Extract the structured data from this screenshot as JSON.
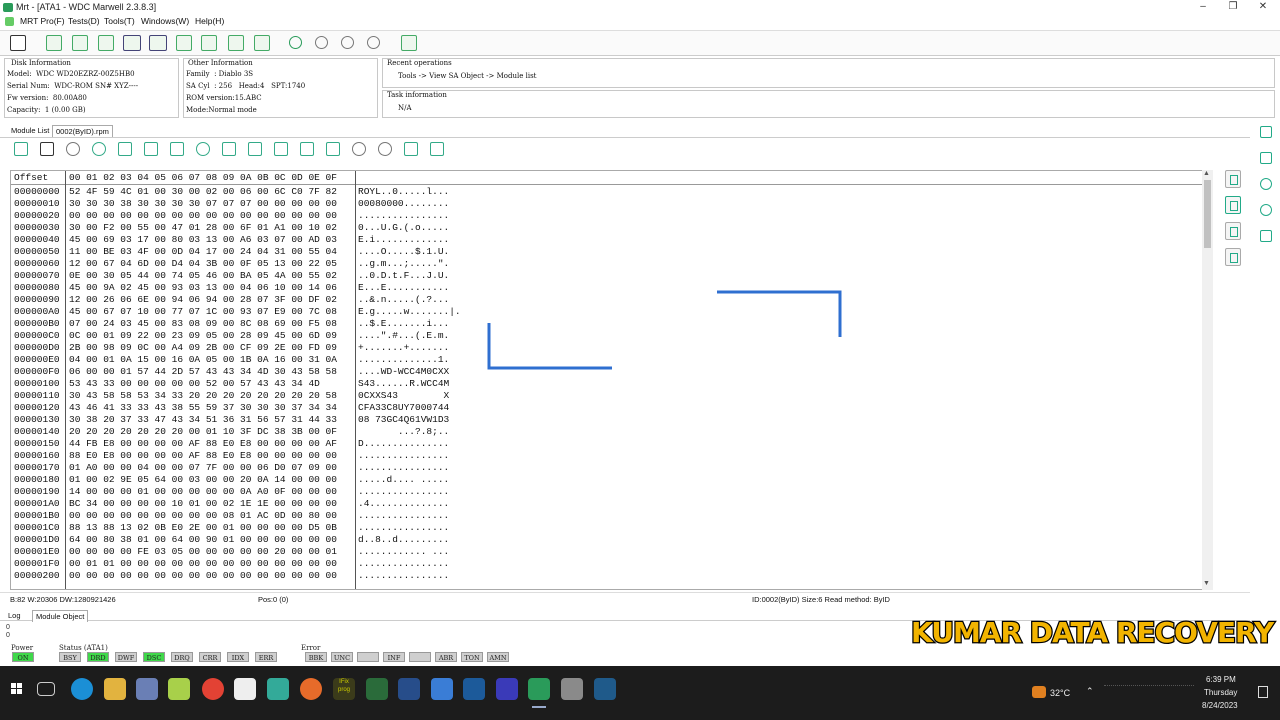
{
  "window": {
    "title": "Mrt - [ATA1 - WDC Marwell 2.3.8.3]",
    "buttons": {
      "minimize": "–",
      "restore": "❐",
      "close": "✕"
    }
  },
  "menu": [
    "MRT Pro(F)",
    "Tests(D)",
    "Tools(T)",
    "Windows(W)",
    "Help(H)"
  ],
  "disk_info": {
    "title": "Disk Information",
    "rows": [
      "Model:  WDC WD20EZRZ-00Z5HB0",
      "Serial Num:  WDC-ROM SN# XYZ----",
      "Fw version:  80.00A80",
      "Capacity:  1 (0.00 GB)"
    ]
  },
  "other_info": {
    "title": "Other Information",
    "rows": [
      "Family  : Diablo 3S",
      "SA Cyl  : 256   Head:4   SPT:1740",
      "ROM version:15.ABC",
      "Mode:Normal mode"
    ]
  },
  "recent_ops": {
    "title": "Recent operations",
    "text": "Tools -> View SA Object -> Module list"
  },
  "task_info": {
    "title": "Task information",
    "text": "N/A"
  },
  "tabs": [
    "Module List",
    "0002(ByID).rpm"
  ],
  "hex": {
    "offset_label": "Offset",
    "columns": [
      "00",
      "01",
      "02",
      "03",
      "04",
      "05",
      "06",
      "07",
      "08",
      "09",
      "0A",
      "0B",
      "0C",
      "0D",
      "0E",
      "0F"
    ],
    "rows": [
      {
        "o": "00000000",
        "b": "52 4F 59 4C 01 00 30 00 02 00 06 00 6C C0 7F 82",
        "a": "ROYL..0.....l..."
      },
      {
        "o": "00000010",
        "b": "30 30 30 38 30 30 30 30 07 07 07 00 00 00 00 00",
        "a": "00080000........"
      },
      {
        "o": "00000020",
        "b": "00 00 00 00 00 00 00 00 00 00 00 00 00 00 00 00",
        "a": "................"
      },
      {
        "o": "00000030",
        "b": "30 00 F2 00 55 00 47 01 28 00 6F 01 A1 00 10 02",
        "a": "0...U.G.(.o....."
      },
      {
        "o": "00000040",
        "b": "45 00 69 03 17 00 80 03 13 00 A6 03 07 00 AD 03",
        "a": "E.i............."
      },
      {
        "o": "00000050",
        "b": "11 00 BE 03 4F 00 0D 04 17 00 24 04 31 00 55 04",
        "a": "....O.....$.1.U."
      },
      {
        "o": "00000060",
        "b": "12 00 67 04 6D 00 D4 04 3B 00 0F 05 13 00 22 05",
        "a": "..g.m...;.....\"."
      },
      {
        "o": "00000070",
        "b": "0E 00 30 05 44 00 74 05 46 00 BA 05 4A 00 55 02",
        "a": "..0.D.t.F...J.U."
      },
      {
        "o": "00000080",
        "b": "45 00 9A 02 45 00 93 03 13 00 04 06 10 00 14 06",
        "a": "E...E..........."
      },
      {
        "o": "00000090",
        "b": "12 00 26 06 6E 00 94 06 94 00 28 07 3F 00 DF 02",
        "a": "..&.n.....(.?..."
      },
      {
        "o": "000000A0",
        "b": "45 00 67 07 10 00 77 07 1C 00 93 07 E9 00 7C 08",
        "a": "E.g.....w.......|."
      },
      {
        "o": "000000B0",
        "b": "07 00 24 03 45 00 83 08 09 00 8C 08 69 00 F5 08",
        "a": "..$.E.......i..."
      },
      {
        "o": "000000C0",
        "b": "0C 00 01 09 22 00 23 09 05 00 28 09 45 00 6D 09",
        "a": "....\".#...(.E.m."
      },
      {
        "o": "000000D0",
        "b": "2B 00 98 09 0C 00 A4 09 2B 00 CF 09 2E 00 FD 09",
        "a": "+.......+......."
      },
      {
        "o": "000000E0",
        "b": "04 00 01 0A 15 00 16 0A 05 00 1B 0A 16 00 31 0A",
        "a": "..............1."
      },
      {
        "o": "000000F0",
        "b": "06 00 00 01 57 44 2D 57 43 43 34 4D 30 43 58 58",
        "a": "....WD-WCC4M0CXX"
      },
      {
        "o": "00000100",
        "b": "53 43 33 00 00 00 00 00 52 00 57 43 43 34 4D",
        "a": "S43......R.WCC4M"
      },
      {
        "o": "00000110",
        "b": "30 43 58 58 53 34 33 20 20 20 20 20 20 20 20 58",
        "a": "0CXXS43        X"
      },
      {
        "o": "00000120",
        "b": "43 46 41 33 33 43 38 55 59 37 30 30 30 37 34 34",
        "a": "CFA33C8UY7000744"
      },
      {
        "o": "00000130",
        "b": "30 38 20 37 33 47 43 34 51 36 31 56 57 31 44 33",
        "a": "08 73GC4Q61VW1D3"
      },
      {
        "o": "00000140",
        "b": "20 20 20 20 20 20 20 00 01 10 3F DC 38 3B 00 0F",
        "a": "       ...?.8;.."
      },
      {
        "o": "00000150",
        "b": "44 FB E8 00 00 00 00 AF 88 E0 E8 00 00 00 00 AF",
        "a": "D..............."
      },
      {
        "o": "00000160",
        "b": "88 E0 E8 00 00 00 00 AF 88 E0 E8 00 00 00 00 00",
        "a": "................"
      },
      {
        "o": "00000170",
        "b": "01 A0 00 00 04 00 00 07 7F 00 00 06 D0 07 09 00",
        "a": "................"
      },
      {
        "o": "00000180",
        "b": "01 00 02 9E 05 64 00 03 00 00 20 0A 14 00 00 00",
        "a": ".....d.... ....."
      },
      {
        "o": "00000190",
        "b": "14 00 00 00 01 00 00 00 00 00 0A A0 0F 00 00 00",
        "a": "................"
      },
      {
        "o": "000001A0",
        "b": "BC 34 00 00 00 00 10 01 00 02 1E 1E 00 00 00 00",
        "a": ".4.............."
      },
      {
        "o": "000001B0",
        "b": "00 00 00 00 00 00 00 00 00 08 01 AC 0D 00 80 00",
        "a": "................"
      },
      {
        "o": "000001C0",
        "b": "88 13 88 13 02 0B E0 2E 00 01 00 00 00 00 D5 0B",
        "a": "................"
      },
      {
        "o": "000001D0",
        "b": "64 00 80 38 01 00 64 00 90 01 00 00 00 00 00 00",
        "a": "d..8..d........."
      },
      {
        "o": "000001E0",
        "b": "00 00 00 00 FE 03 05 00 00 00 00 00 20 00 00 01",
        "a": "............ ..."
      },
      {
        "o": "000001F0",
        "b": "00 01 01 00 00 00 00 00 00 00 00 00 00 00 00 00",
        "a": "................"
      },
      {
        "o": "00000200",
        "b": "00 00 00 00 00 00 00 00 00 00 00 00 00 00 00 00",
        "a": "................"
      }
    ]
  },
  "status_bar": {
    "left": "B:82 W:20306 DW:1280921426",
    "pos": "Pos:0 (0)",
    "right": "ID:0002(ByID)  Size:6  Read method: ByID"
  },
  "bottom_tabs": [
    "Log",
    "Module Object"
  ],
  "log_lines": [
    "0",
    "0"
  ],
  "power": {
    "title": "Power",
    "leds": [
      {
        "label": "ON",
        "on": true
      }
    ]
  },
  "status": {
    "title": "Status (ATA1)",
    "leds": [
      {
        "label": "BSY",
        "on": false
      },
      {
        "label": "DRD",
        "on": true
      },
      {
        "label": "DWF",
        "on": false
      },
      {
        "label": "DSC",
        "on": true
      },
      {
        "label": "DRQ",
        "on": false
      },
      {
        "label": "CRR",
        "on": false
      },
      {
        "label": "IDX",
        "on": false
      },
      {
        "label": "ERR",
        "on": false
      }
    ]
  },
  "error": {
    "title": "Error",
    "leds": [
      {
        "label": "BBK",
        "on": false
      },
      {
        "label": "UNC",
        "on": false
      },
      {
        "label": "",
        "on": false
      },
      {
        "label": "INF",
        "on": false
      },
      {
        "label": "",
        "on": false
      },
      {
        "label": "ABR",
        "on": false
      },
      {
        "label": "TON",
        "on": false
      },
      {
        "label": "AMN",
        "on": false
      }
    ]
  },
  "watermark": "KUMAR DATA RECOVERY",
  "taskbar": {
    "weather": "32°C",
    "time": "6:39 PM",
    "day": "Thursday",
    "date": "8/24/2023",
    "prog_label": "IFix\nprog"
  },
  "colors": {
    "accent": "#2a9b5a",
    "led_on": "#3fd84a",
    "drawing_blue": "#2f6fd0",
    "watermark": "#f2b400"
  }
}
